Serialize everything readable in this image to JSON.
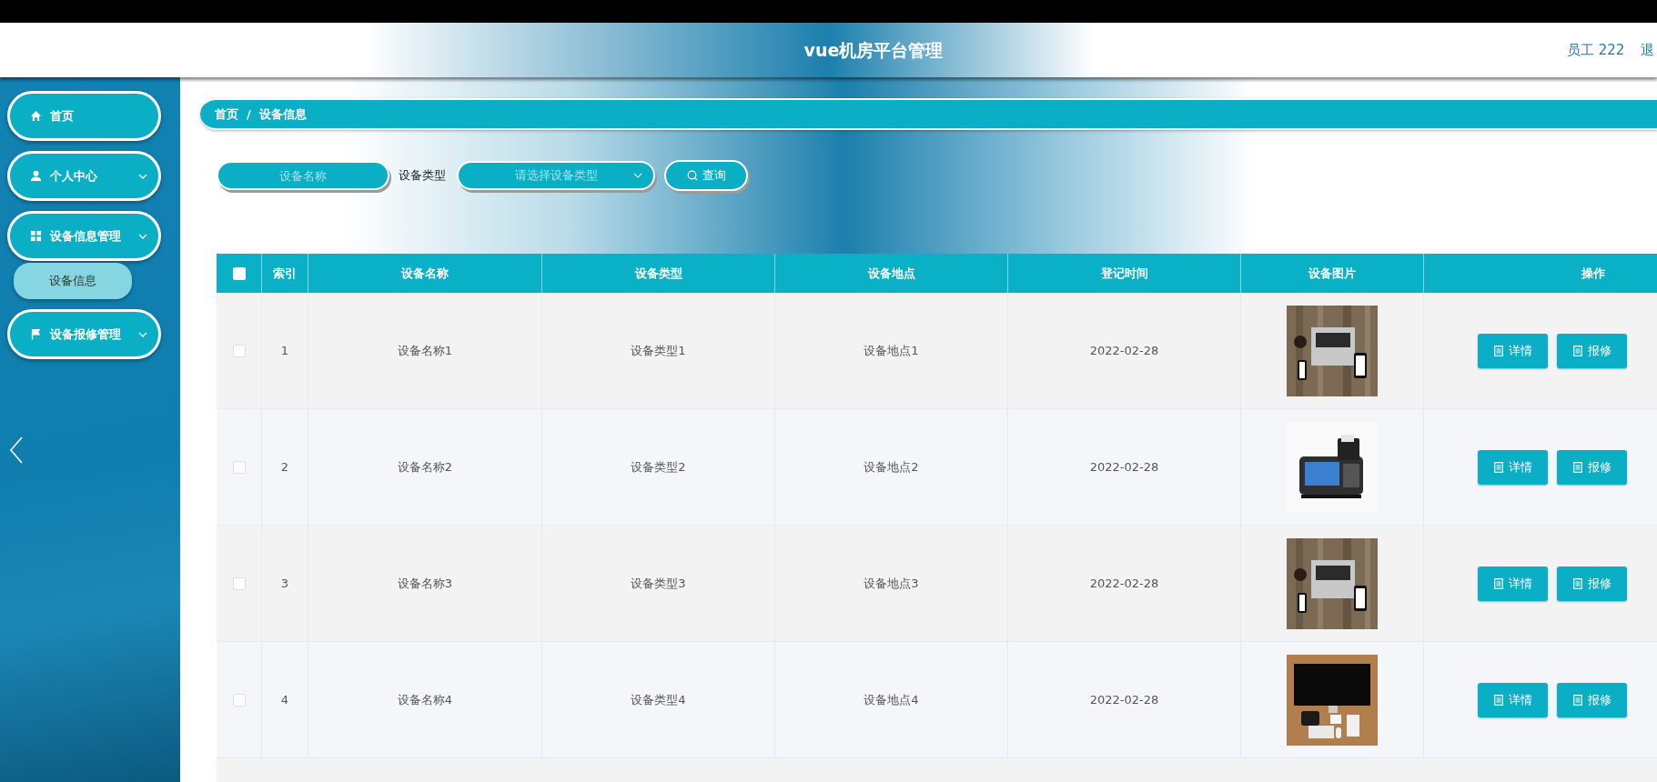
{
  "header": {
    "title": "vue机房平台管理",
    "user": "员工 222",
    "logout": "退"
  },
  "sidebar": {
    "items": [
      {
        "label": "首页",
        "kind": "home",
        "selected": false
      },
      {
        "label": "个人中心",
        "kind": "user",
        "selected": false,
        "submenu": true
      },
      {
        "label": "设备信息管理",
        "kind": "grid",
        "selected": false,
        "submenu": true,
        "children": [
          {
            "label": "设备信息",
            "selected": true
          }
        ]
      },
      {
        "label": "设备报修管理",
        "kind": "flag",
        "selected": false,
        "submenu": true
      }
    ]
  },
  "breadcrumb": {
    "items": [
      "首页",
      "设备信息"
    ],
    "separator": "/"
  },
  "search": {
    "name_placeholder": "设备名称",
    "type_label": "设备类型",
    "type_placeholder": "请选择设备类型",
    "button": "查询"
  },
  "table": {
    "select_all_checked": false,
    "columns": [
      "索引",
      "设备名称",
      "设备类型",
      "设备地点",
      "登记时间",
      "设备图片",
      "操作"
    ],
    "rows": [
      {
        "checked": false,
        "cells": [
          "1",
          "设备名称1",
          "设备类型1",
          "设备地点1",
          "2022-02-28"
        ],
        "actions": [
          "详情",
          "报修"
        ]
      },
      {
        "checked": false,
        "cells": [
          "2",
          "设备名称2",
          "设备类型2",
          "设备地点2",
          "2022-02-28"
        ],
        "actions": [
          "详情",
          "报修"
        ]
      },
      {
        "checked": false,
        "cells": [
          "3",
          "设备名称3",
          "设备类型3",
          "设备地点3",
          "2022-02-28"
        ],
        "actions": [
          "详情",
          "报修"
        ]
      },
      {
        "checked": false,
        "cells": [
          "4",
          "设备名称4",
          "设备类型4",
          "设备地点4",
          "2022-02-28"
        ],
        "actions": [
          "详情",
          "报修"
        ]
      }
    ]
  }
}
